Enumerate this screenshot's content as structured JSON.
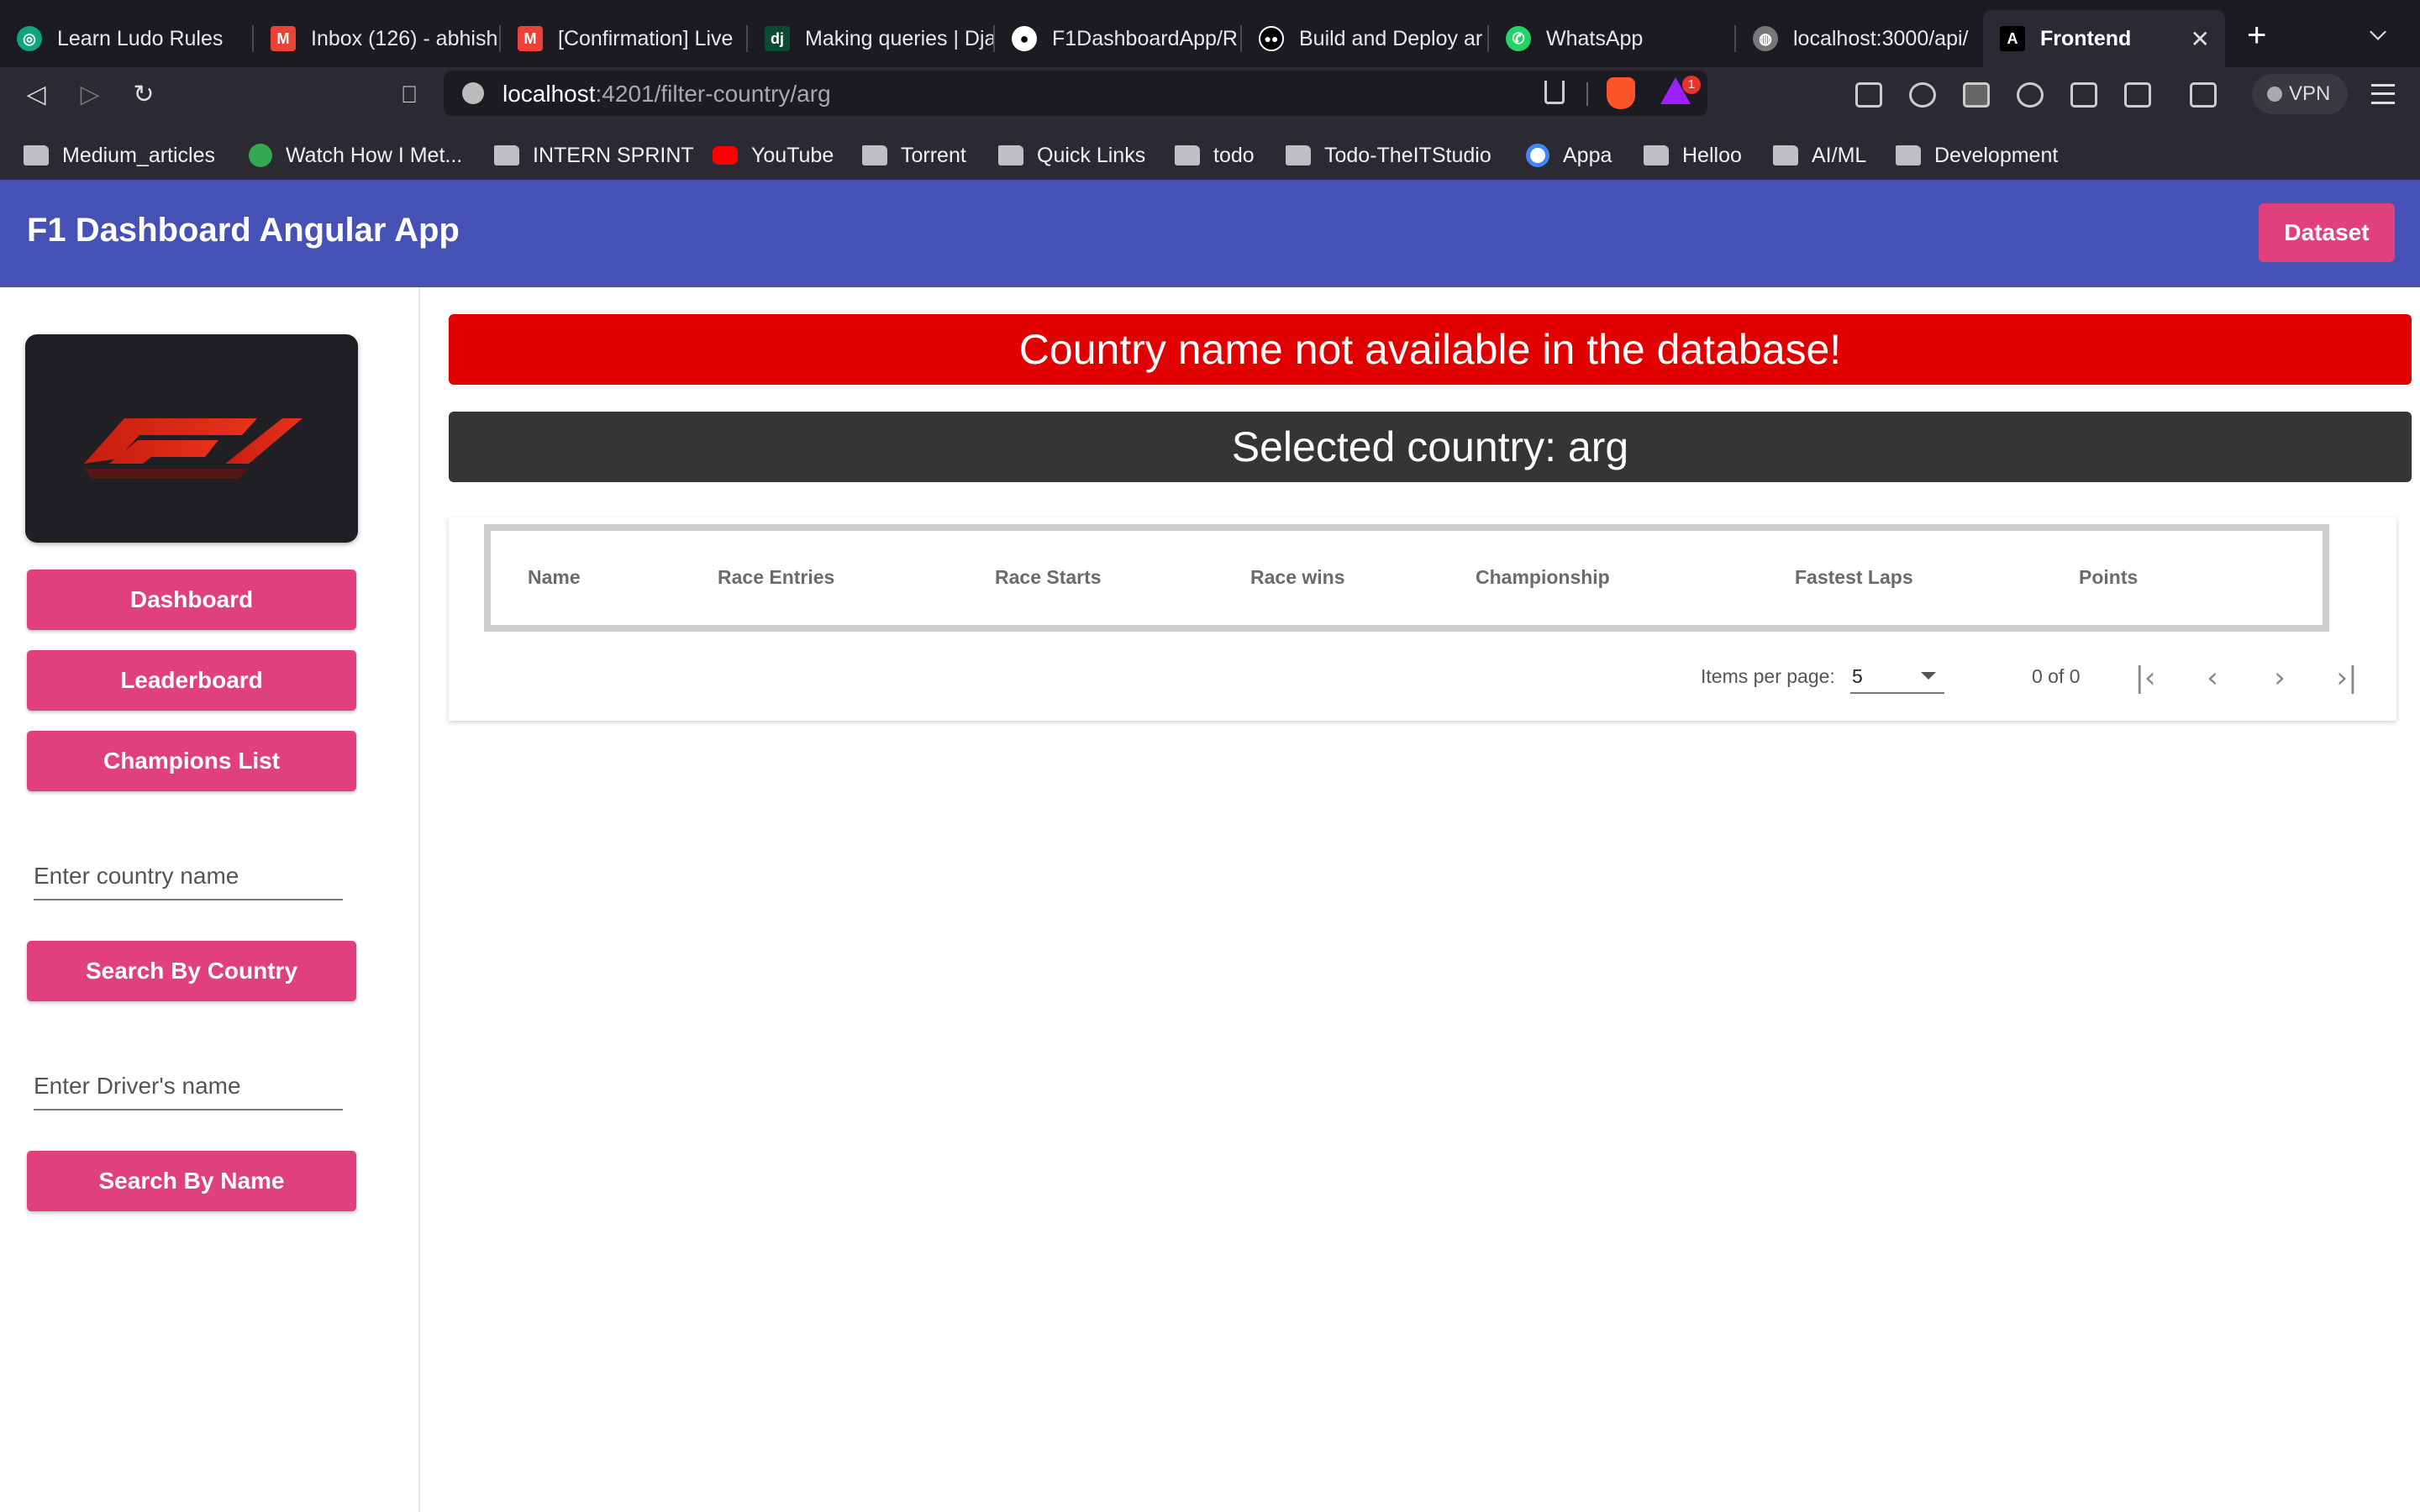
{
  "tabs": [
    {
      "title": "Learn Ludo Rules",
      "icon": "chatgpt-icon",
      "color": "#10a37f"
    },
    {
      "title": "Inbox (126) - abhish",
      "icon": "gmail-icon",
      "color": "#ea4335"
    },
    {
      "title": "[Confirmation] Live",
      "icon": "gmail-icon",
      "color": "#ea4335"
    },
    {
      "title": "Making queries | Dja",
      "icon": "django-icon",
      "color": "#0c4b33"
    },
    {
      "title": "F1DashboardApp/R",
      "icon": "github-icon",
      "color": "#ffffff"
    },
    {
      "title": "Build and Deploy ar",
      "icon": "medium-icon",
      "color": "#000000"
    },
    {
      "title": "WhatsApp",
      "icon": "whatsapp-icon",
      "color": "#25d366"
    },
    {
      "title": "localhost:3000/api/",
      "icon": "globe-icon",
      "color": "#888888"
    },
    {
      "title": "Frontend",
      "icon": "angular-icon",
      "color": "#000000",
      "active": true
    }
  ],
  "url": {
    "host": "localhost",
    "rest": ":4201/filter-country/arg"
  },
  "brave_badge": "1",
  "vpn_label": "VPN",
  "bookmarks": [
    {
      "label": "Medium_articles",
      "icon": "folder"
    },
    {
      "label": "Watch How I Met...",
      "icon": "play"
    },
    {
      "label": "INTERN SPRINT",
      "icon": "folder"
    },
    {
      "label": "YouTube",
      "icon": "yt"
    },
    {
      "label": "Torrent",
      "icon": "folder"
    },
    {
      "label": "Quick Links",
      "icon": "folder"
    },
    {
      "label": "todo",
      "icon": "folder"
    },
    {
      "label": "Todo-TheITStudio",
      "icon": "folder"
    },
    {
      "label": "Appa",
      "icon": "g"
    },
    {
      "label": "Helloo",
      "icon": "folder"
    },
    {
      "label": "AI/ML",
      "icon": "folder"
    },
    {
      "label": "Development",
      "icon": "folder"
    }
  ],
  "app": {
    "title": "F1 Dashboard Angular App",
    "dataset_label": "Dataset"
  },
  "sidebar": {
    "dashboard_label": "Dashboard",
    "leaderboard_label": "Leaderboard",
    "champions_label": "Champions List",
    "country_placeholder": "Enter country name",
    "search_country_label": "Search By Country",
    "driver_placeholder": "Enter Driver's name",
    "search_name_label": "Search By Name"
  },
  "main": {
    "error_message": "Country name not available in the database!",
    "selected_country": "Selected country: arg",
    "columns": [
      "Name",
      "Race Entries",
      "Race Starts",
      "Race wins",
      "Championship",
      "Fastest Laps",
      "Points"
    ],
    "paginator": {
      "items_per_page_label": "Items per page:",
      "page_size": "5",
      "range": "0 of 0"
    }
  },
  "colors": {
    "header": "#4551b5",
    "accent": "#e0407b",
    "error": "#e00000",
    "banner_dark": "#333536"
  }
}
